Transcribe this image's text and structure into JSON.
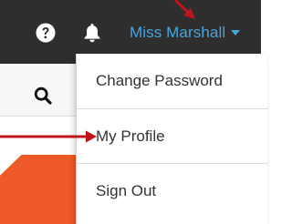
{
  "topbar": {
    "help_icon": "question-circle",
    "notifications_icon": "bell",
    "user_name": "Miss Marshall",
    "user_caret_icon": "caret-down",
    "background": "#2e2e2e",
    "user_name_color": "#47a5dd"
  },
  "search": {
    "icon": "magnifier"
  },
  "user_menu": {
    "items": [
      {
        "label": "Change Password"
      },
      {
        "label": "My Profile"
      },
      {
        "label": "Sign Out"
      }
    ]
  },
  "annotations": {
    "arrow_color": "#c0141c",
    "arrows": [
      "pointer-to-user-menu",
      "pointer-to-my-profile"
    ]
  },
  "accent": {
    "orange": "#ee5a28"
  }
}
